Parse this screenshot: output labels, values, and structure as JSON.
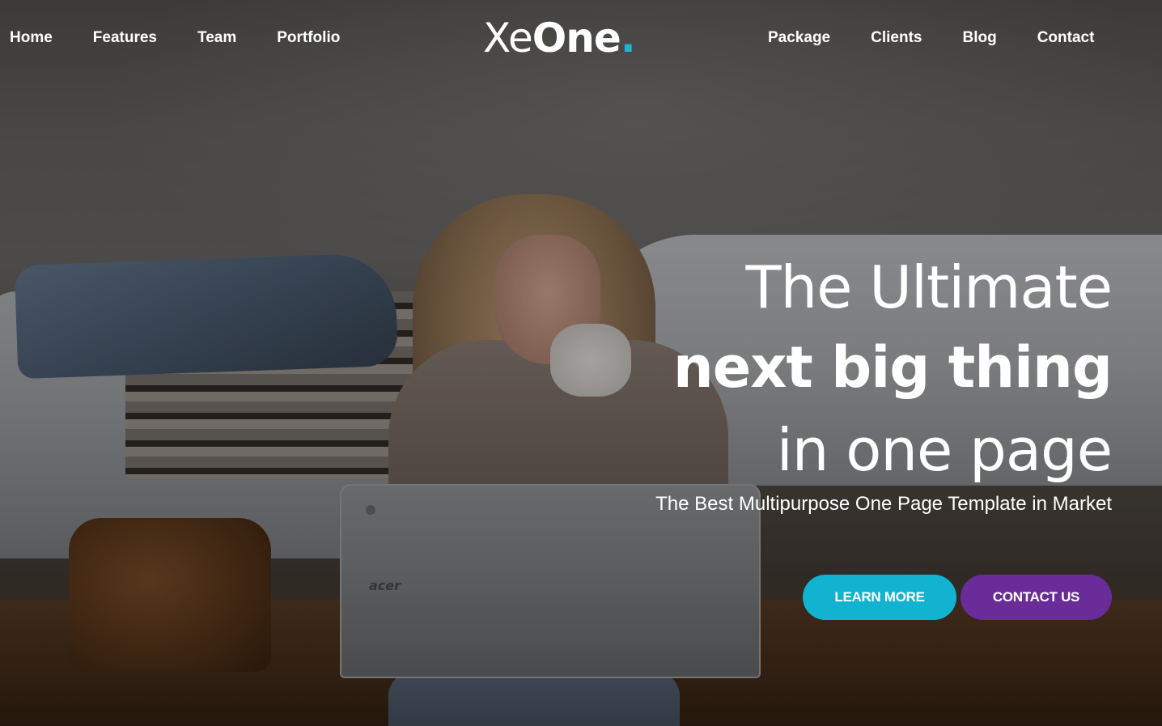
{
  "nav": {
    "left": [
      "Home",
      "Features",
      "Team",
      "Portfolio"
    ],
    "right": [
      "Package",
      "Clients",
      "Blog",
      "Contact"
    ]
  },
  "logo": {
    "light": "Xe",
    "bold": "One",
    "dot": ".",
    "accent_color": "#19b5d3"
  },
  "hero": {
    "line1": "The Ultimate",
    "line2": "next big thing",
    "line3": "in one page",
    "subtitle": "The Best Multipurpose One Page Template in Market",
    "learn_more": "LEARN MORE",
    "contact_us": "CONTACT US",
    "learn_color": "#12b3d1",
    "contact_color": "#6a2c98"
  },
  "background": {
    "laptop_brand": "acer"
  }
}
